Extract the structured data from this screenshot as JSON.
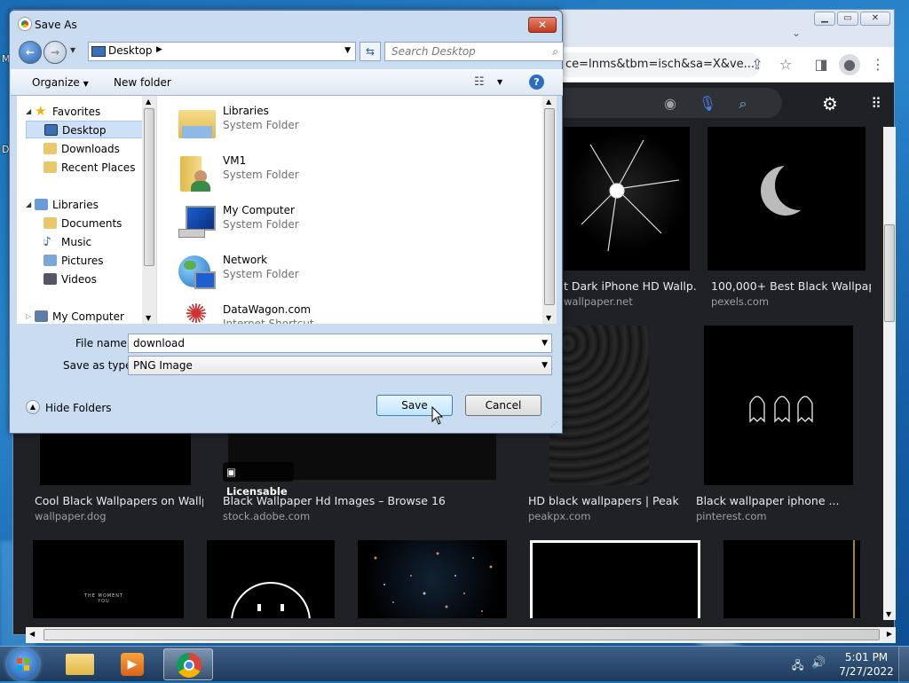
{
  "desktop": {
    "label_top": "M",
    "label_mid": "D"
  },
  "browser": {
    "omnibox_text": "ce=lnms&tbm=isch&sa=X&ve...",
    "results": [
      {
        "caption": "t Dark iPhone HD Wallp...",
        "source": "wallpaper.net"
      },
      {
        "caption": "100,000+ Best Black Wallpap...",
        "source": "pexels.com"
      },
      {
        "caption": "Cool Black Wallpapers on Wallp...",
        "source": "wallpaper.dog"
      },
      {
        "caption": "Black Wallpaper Hd Images – Browse 16 ...",
        "source": "stock.adobe.com"
      },
      {
        "caption": "HD black wallpapers | Peak...",
        "source": "peakpx.com"
      },
      {
        "caption": "Black wallpaper iphone ...",
        "source": "pinterest.com"
      }
    ],
    "licensable_badge": "Licensable",
    "tile_text": "THE MOMENT YOU"
  },
  "dialog": {
    "title": "Save As",
    "address": "Desktop",
    "search_placeholder": "Search Desktop",
    "organize": "Organize",
    "new_folder": "New folder",
    "nav": {
      "favorites": "Favorites",
      "desktop": "Desktop",
      "downloads": "Downloads",
      "recent": "Recent Places",
      "libraries": "Libraries",
      "documents": "Documents",
      "music": "Music",
      "pictures": "Pictures",
      "videos": "Videos",
      "mycomputer": "My Computer"
    },
    "files": [
      {
        "name": "Libraries",
        "type": "System Folder"
      },
      {
        "name": "VM1",
        "type": "System Folder"
      },
      {
        "name": "My Computer",
        "type": "System Folder"
      },
      {
        "name": "Network",
        "type": "System Folder"
      },
      {
        "name": "DataWagon.com",
        "type": "Internet Shortcut"
      }
    ],
    "filename_label": "File name:",
    "filename_value": "download",
    "savetype_label": "Save as type:",
    "savetype_value": "PNG Image",
    "hide_folders": "Hide Folders",
    "save": "Save",
    "cancel": "Cancel"
  },
  "taskbar": {
    "time": "5:01 PM",
    "date": "7/27/2022"
  }
}
